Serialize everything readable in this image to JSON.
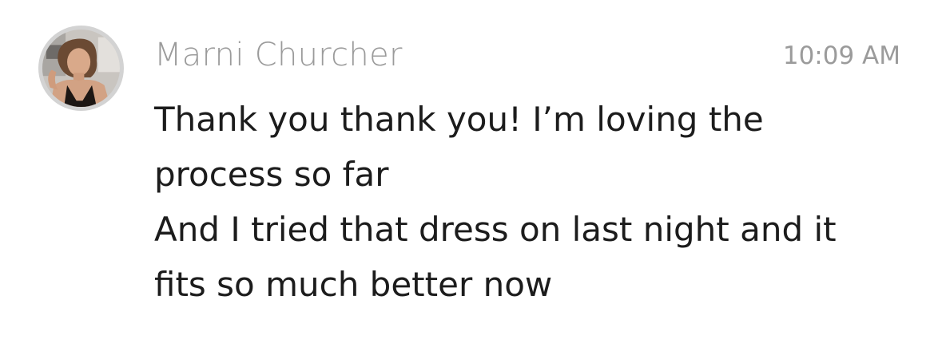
{
  "message": {
    "avatar_icon": "user-avatar-photo",
    "sender_name": "Marni Churcher",
    "timestamp": "10:09 AM",
    "lines": [
      "Thank you thank you! I’m loving the",
      "process so far",
      "And I tried that dress on last night and it",
      "fits so much better now"
    ]
  },
  "colors": {
    "meta_text": "#9b9b9b",
    "body_text": "#1c1c1c",
    "avatar_ring": "#d3d3d3",
    "background": "#ffffff"
  }
}
